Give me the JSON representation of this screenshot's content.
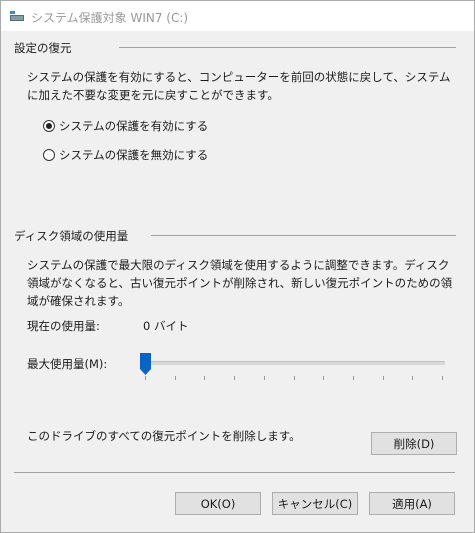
{
  "window": {
    "title": "システム保護対象 WIN7 (C:)"
  },
  "restore_settings": {
    "header": "設定の復元",
    "description": "システムの保護を有効にすると、コンピューターを前回の状態に戻して、システムに加えた不要な変更を元に戻すことができます。",
    "options": [
      {
        "label": "システムの保護を有効にする",
        "selected": true
      },
      {
        "label": "システムの保護を無効にする",
        "selected": false
      }
    ]
  },
  "disk_usage": {
    "header": "ディスク領域の使用量",
    "description": "システムの保護で最大限のディスク領域を使用するように調整できます。ディスク領域がなくなると、古い復元ポイントが削除され、新しい復元ポイントのための領域が確保されます。",
    "current_usage_label": "現在の使用量:",
    "current_usage_value": "0 バイト",
    "max_usage_label": "最大使用量(M):",
    "max_usage_fraction": 0.0
  },
  "delete_section": {
    "text": "このドライブのすべての復元ポイントを削除します。",
    "button_label": "削除(D)"
  },
  "footer": {
    "ok_label": "OK(O)",
    "cancel_label": "キャンセル(C)",
    "apply_label": "適用(A)"
  },
  "colors": {
    "slider_thumb": "#0a64c8",
    "title_text": "#9a9a9a"
  }
}
